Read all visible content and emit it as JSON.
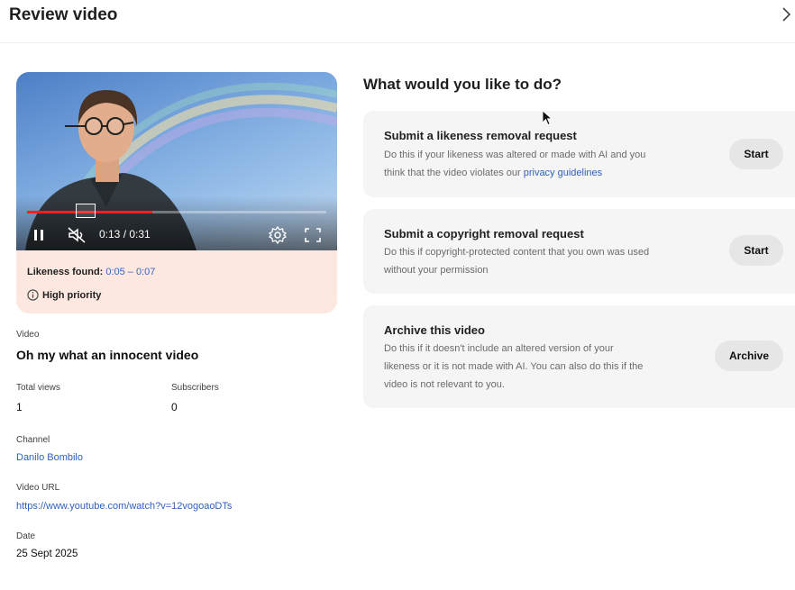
{
  "header": {
    "title": "Review video",
    "close_icon": "chevron-right-icon"
  },
  "player": {
    "time": "0:13 / 0:31",
    "progress": 0.42,
    "icons": [
      "pause-icon",
      "mute-icon",
      "settings-icon",
      "fullscreen-icon"
    ]
  },
  "likeness": {
    "label": "Likeness found:",
    "range": "0:05 – 0:07",
    "priority": "High priority",
    "priority_icon": "info-icon"
  },
  "details": {
    "video_label": "Video",
    "video_title": "Oh my what an innocent video",
    "views_label": "Total views",
    "views_value": "1",
    "subscribers_label": "Subscribers",
    "subscribers_value": "0",
    "channel_label": "Channel",
    "channel_value": "Danilo Bombilo",
    "url_label": "Video URL",
    "url_value": "https://www.youtube.com/watch?v=12vogoaoDTs",
    "date_label": "Date",
    "date_value": "25 Sept 2025"
  },
  "actions": {
    "question": "What would you like to do?",
    "options": [
      {
        "title": "Submit a likeness removal request",
        "desc_line1": "Do this if your likeness was altered or made with AI and you",
        "desc_line2_prefix": "think that the video violates our ",
        "desc_link": "privacy guidelines",
        "button": "Start"
      },
      {
        "title": "Submit a copyright removal request",
        "desc_line1": "Do this if copyright-protected content that you own was used",
        "desc_line2": "without your permission",
        "button": "Start"
      },
      {
        "title": "Archive this video",
        "desc_line1": "Do this if it doesn't include an altered version of your",
        "desc_line2": "likeness or it is not made with AI. You can also do this if the",
        "desc_line3": "video is not relevant to you.",
        "button": "Archive"
      }
    ]
  },
  "colors": {
    "accent_link": "#2f5fbf",
    "progress_red": "#ff1f1f",
    "likeness_bg": "#fde8e1",
    "card_bg": "#f5f5f5",
    "button_bg": "#e6e6e6"
  }
}
